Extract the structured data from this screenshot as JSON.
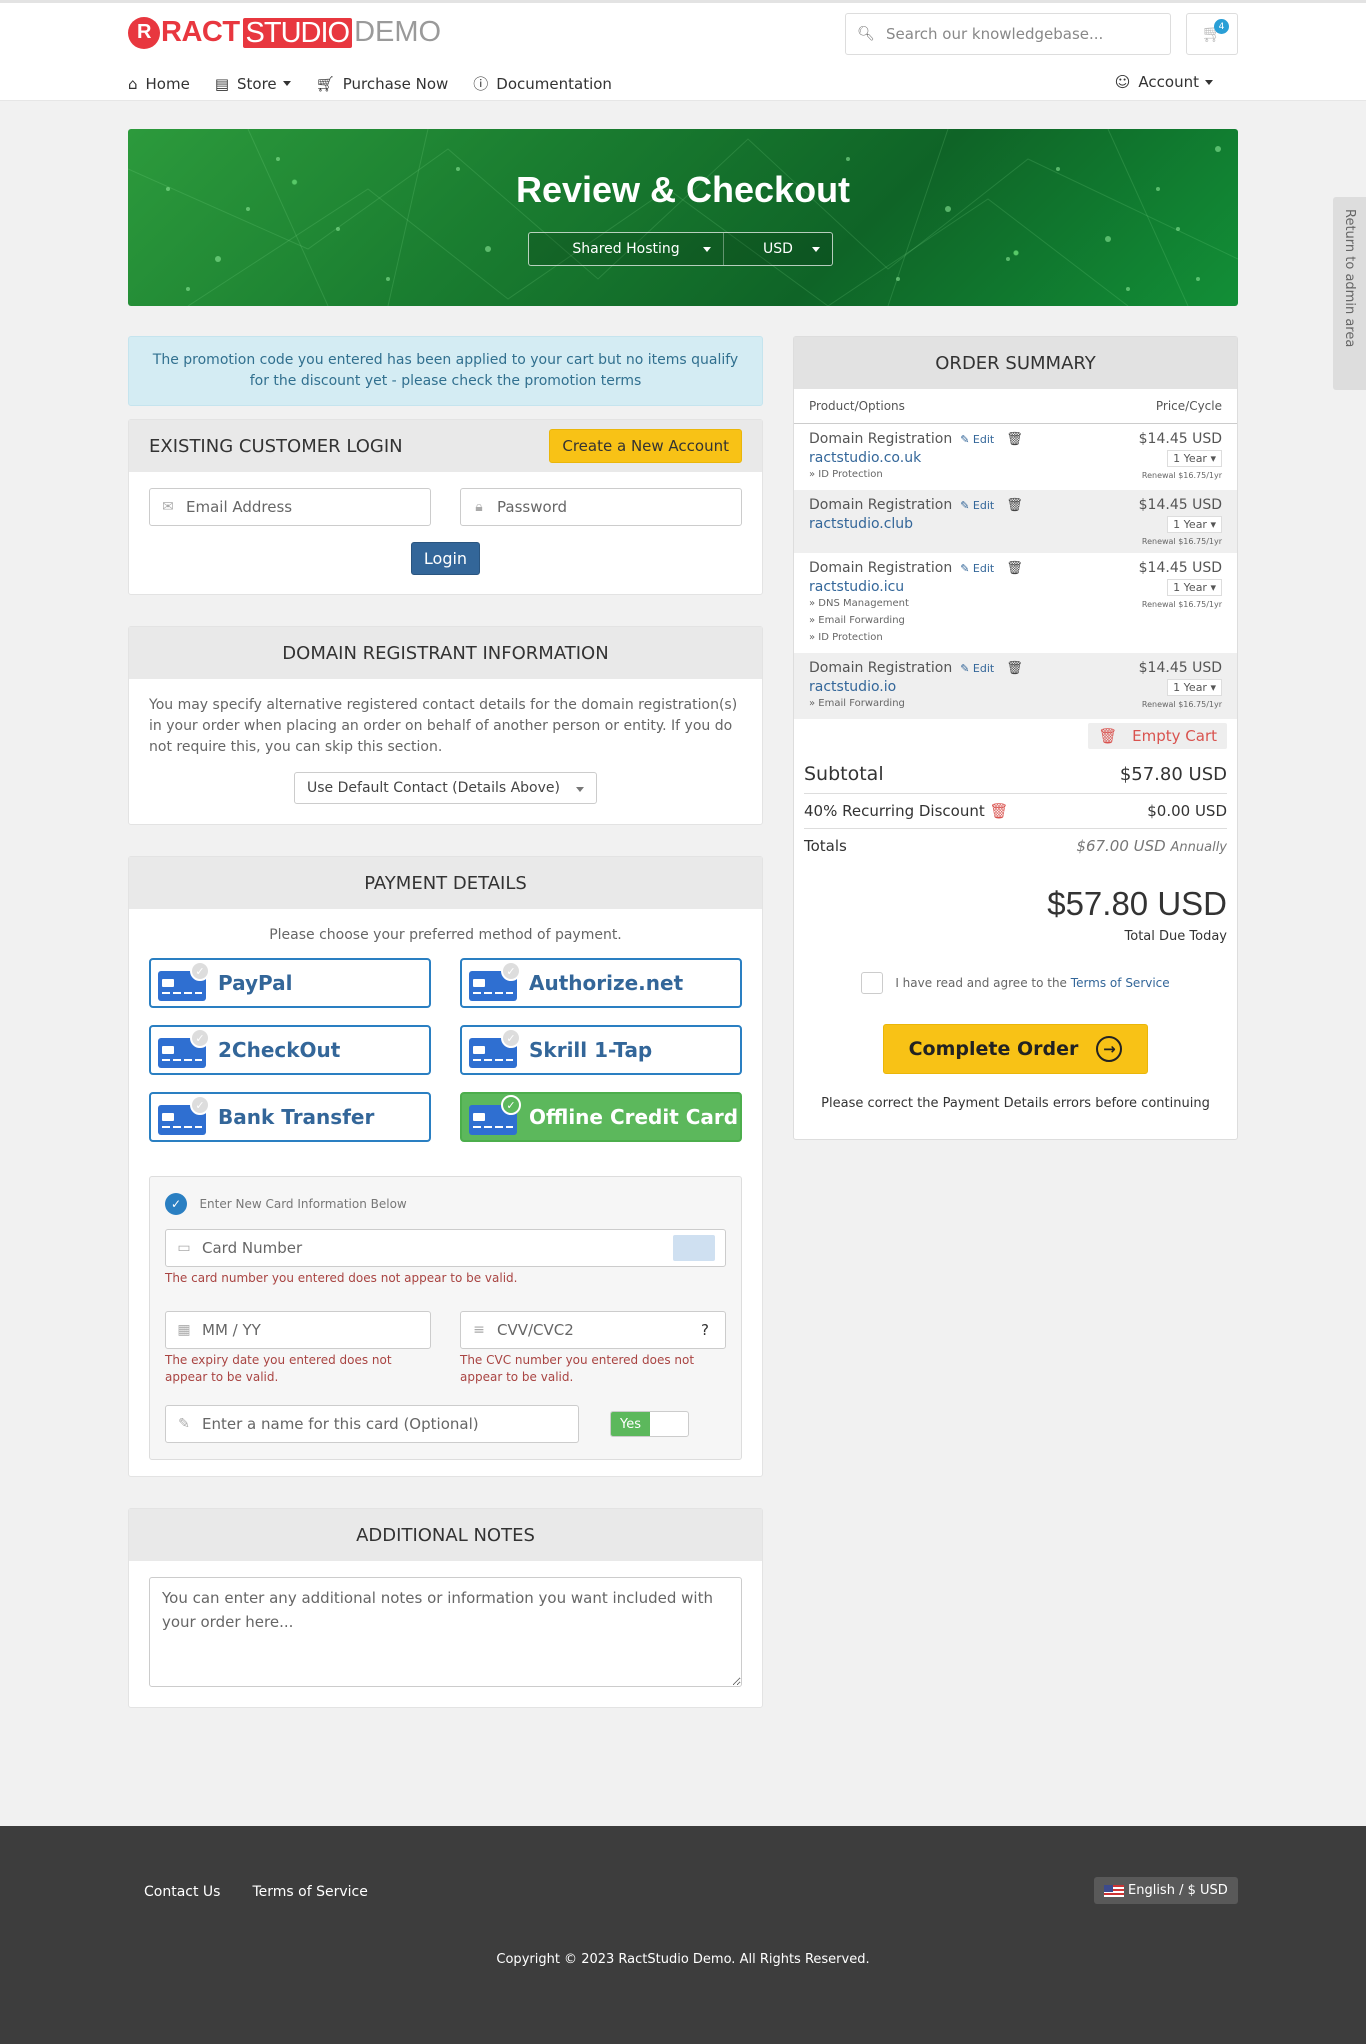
{
  "header": {
    "logo": {
      "mark": "R",
      "ract": "RACT",
      "studio": "STUDIO",
      "demo": "DEMO"
    },
    "search_placeholder": "Search our knowledgebase...",
    "cart_count": "4",
    "nav": [
      {
        "label": "Home",
        "icon": "home-icon"
      },
      {
        "label": "Store",
        "icon": "store-icon"
      },
      {
        "label": "Purchase Now",
        "icon": "cart-icon"
      },
      {
        "label": "Documentation",
        "icon": "info-icon"
      }
    ],
    "account_label": "Account"
  },
  "hero": {
    "title": "Review & Checkout",
    "category": "Shared Hosting",
    "currency": "USD"
  },
  "admin_tab": "Return to admin area",
  "promo_alert": "The promotion code you entered has been applied to your cart but no items qualify for the discount yet - please check the promotion terms",
  "login": {
    "title": "EXISTING CUSTOMER LOGIN",
    "create_account": "Create a New Account",
    "email_placeholder": "Email Address",
    "password_placeholder": "Password",
    "login_button": "Login"
  },
  "registrant": {
    "title": "DOMAIN REGISTRANT INFORMATION",
    "description": "You may specify alternative registered contact details for the domain registration(s) in your order when placing an order on behalf of another person or entity. If you do not require this, you can skip this section.",
    "contact_select": "Use Default Contact (Details Above)"
  },
  "payment": {
    "title": "PAYMENT DETAILS",
    "prompt": "Please choose your preferred method of payment.",
    "methods": [
      "PayPal",
      "Authorize.net",
      "2CheckOut",
      "Skrill 1-Tap",
      "Bank Transfer",
      "Offline Credit Card"
    ],
    "selected": "Offline Credit Card",
    "card": {
      "new_card_label": "Enter New Card Information Below",
      "card_number_placeholder": "Card Number",
      "card_number_error": "The card number you entered does not appear to be valid.",
      "expiry_placeholder": "MM / YY",
      "expiry_error": "The expiry date you entered does not appear to be valid.",
      "cvv_placeholder": "CVV/CVC2",
      "cvv_help": "?",
      "cvv_error": "The CVC number you entered does not appear to be valid.",
      "name_placeholder": "Enter a name for this card (Optional)",
      "toggle_label": "Yes"
    }
  },
  "notes": {
    "title": "ADDITIONAL NOTES",
    "placeholder": "You can enter any additional notes or information you want included with your order here..."
  },
  "summary": {
    "title": "ORDER SUMMARY",
    "col_product": "Product/Options",
    "col_price": "Price/Cycle",
    "edit_label": "Edit",
    "items": [
      {
        "name": "Domain Registration",
        "domain": "ractstudio.co.uk",
        "options": [
          "» ID Protection"
        ],
        "price": "$14.45 USD",
        "cycle": "1 Year",
        "renewal": "Renewal $16.75/1yr"
      },
      {
        "name": "Domain Registration",
        "domain": "ractstudio.club",
        "options": [],
        "price": "$14.45 USD",
        "cycle": "1 Year",
        "renewal": "Renewal $16.75/1yr"
      },
      {
        "name": "Domain Registration",
        "domain": "ractstudio.icu",
        "options": [
          "» DNS Management",
          "» Email Forwarding",
          "» ID Protection"
        ],
        "price": "$14.45 USD",
        "cycle": "1 Year",
        "renewal": "Renewal $16.75/1yr"
      },
      {
        "name": "Domain Registration",
        "domain": "ractstudio.io",
        "options": [
          "» Email Forwarding"
        ],
        "price": "$14.45 USD",
        "cycle": "1 Year",
        "renewal": "Renewal $16.75/1yr"
      }
    ],
    "empty_cart": "Empty Cart",
    "subtotal_label": "Subtotal",
    "subtotal": "$57.80 USD",
    "discount_label": "40% Recurring Discount",
    "discount": "$0.00 USD",
    "totals_label": "Totals",
    "totals": "$67.00 USD",
    "totals_cycle": "Annually",
    "total_due": "$57.80 USD",
    "total_due_label": "Total Due Today",
    "tos_prefix": "I have read and agree to the",
    "tos_link": "Terms of Service",
    "complete_button": "Complete Order",
    "warning": "Please correct the Payment Details errors before continuing"
  },
  "footer": {
    "links": [
      "Contact Us",
      "Terms of Service"
    ],
    "language": "English / $ USD",
    "copyright": "Copyright © 2023 RactStudio Demo. All Rights Reserved."
  }
}
